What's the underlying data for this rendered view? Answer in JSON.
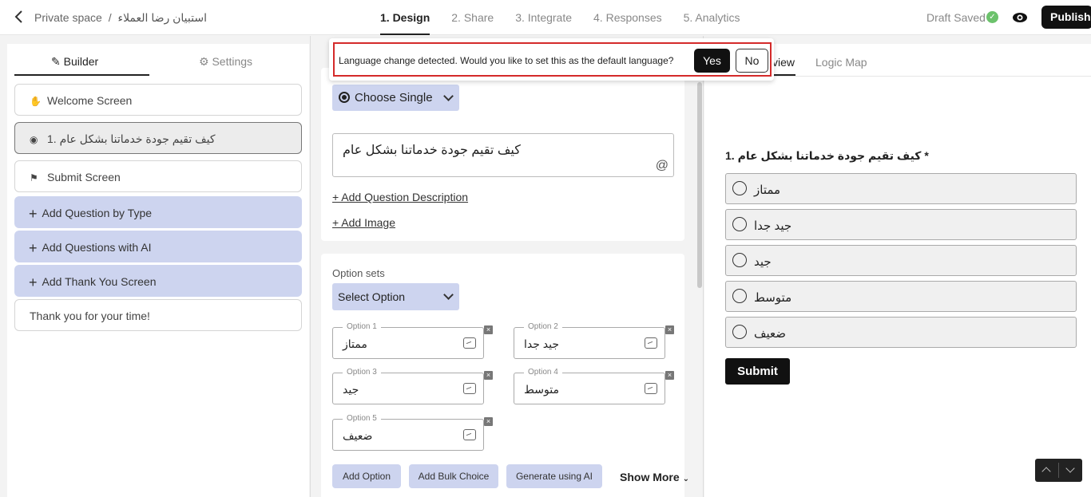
{
  "breadcrumb": {
    "space": "Private space",
    "separator": "/",
    "form_name": "استبيان رضا العملاء"
  },
  "steps": [
    "1. Design",
    "2. Share",
    "3. Integrate",
    "4. Responses",
    "5. Analytics"
  ],
  "status": {
    "draft": "Draft Saved",
    "publish": "Publish"
  },
  "left_tabs": {
    "builder": "Builder",
    "settings": "Settings"
  },
  "left_items": {
    "welcome": "Welcome Screen",
    "question": "1. كيف تقيم جودة خدماتنا بشكل عام",
    "submit": "Submit Screen",
    "add_by_type": "Add Question by Type",
    "add_ai": "Add Questions with AI",
    "add_thank": "Add Thank You Screen",
    "thank": "Thank you for your time!"
  },
  "editor": {
    "question_type": "Choose Single",
    "question_text": "كيف تقيم جودة خدماتنا بشكل عام",
    "add_description": "+ Add Question Description",
    "add_image": "+ Add Image",
    "option_sets_label": "Option sets",
    "select_option": "Select Option",
    "options": [
      {
        "label": "Option 1",
        "value": "ممتاز"
      },
      {
        "label": "Option 2",
        "value": "جيد جدا"
      },
      {
        "label": "Option 3",
        "value": "جيد"
      },
      {
        "label": "Option 4",
        "value": "متوسط"
      },
      {
        "label": "Option 5",
        "value": "ضعيف"
      }
    ],
    "add_option": "Add Option",
    "add_bulk": "Add Bulk Choice",
    "generate_ai": "Generate using AI",
    "show_more": "Show More"
  },
  "preview": {
    "tab_preview": "view",
    "tab_logic": "Logic Map",
    "question": "1. كيف تقيم جودة خدماتنا بشكل عام *",
    "options": [
      "ممتاز",
      "جيد جدا",
      "جيد",
      "متوسط",
      "ضعيف"
    ],
    "submit": "Submit"
  },
  "popup": {
    "text": "Language change detected. Would you like to set this as the default language?",
    "yes": "Yes",
    "no": "No"
  },
  "colors": {
    "accent_blue": "#cdd4ef",
    "highlight_red": "#d42a2a",
    "saved_green": "#6cc26c"
  }
}
